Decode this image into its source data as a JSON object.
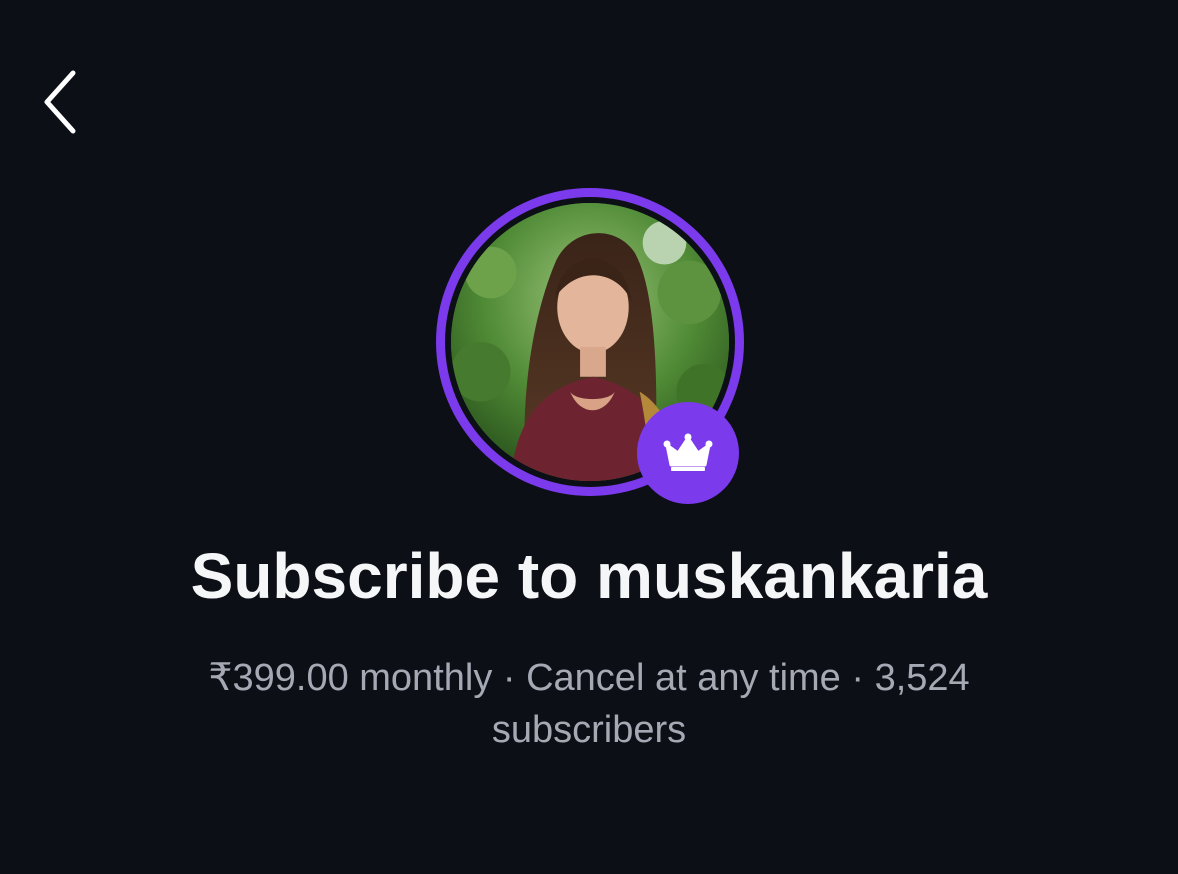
{
  "header": {
    "back_icon": "chevron-left-icon"
  },
  "profile": {
    "avatar_ring_color": "#7c3aed",
    "badge_icon": "crown-icon",
    "badge_color": "#7c3aed"
  },
  "subscribe": {
    "title": "Subscribe to muskankaria",
    "details": "₹399.00 monthly · Cancel at any time · 3,524 subscribers"
  }
}
